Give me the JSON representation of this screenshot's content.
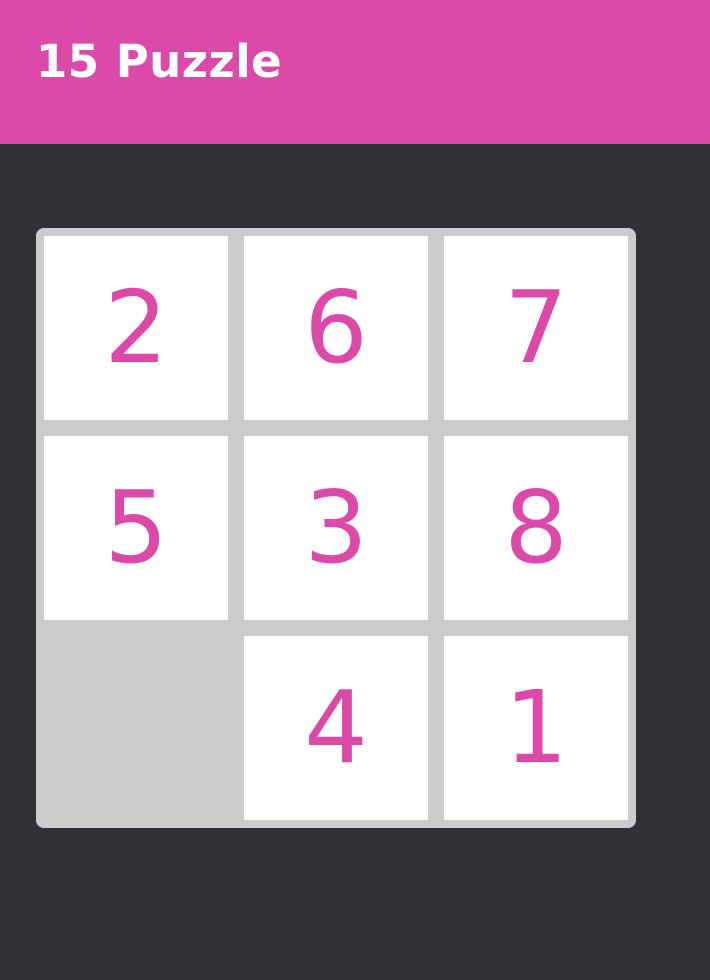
{
  "app_bar": {
    "title": "15 Puzzle"
  },
  "colors": {
    "accent": "#dc4aa9",
    "background": "#303136",
    "board": "#cccccc",
    "tile": "#ffffff"
  },
  "board": {
    "rows": 3,
    "cols": 3,
    "tiles": [
      "2",
      "6",
      "7",
      "5",
      "3",
      "8",
      "",
      "4",
      "1"
    ]
  }
}
